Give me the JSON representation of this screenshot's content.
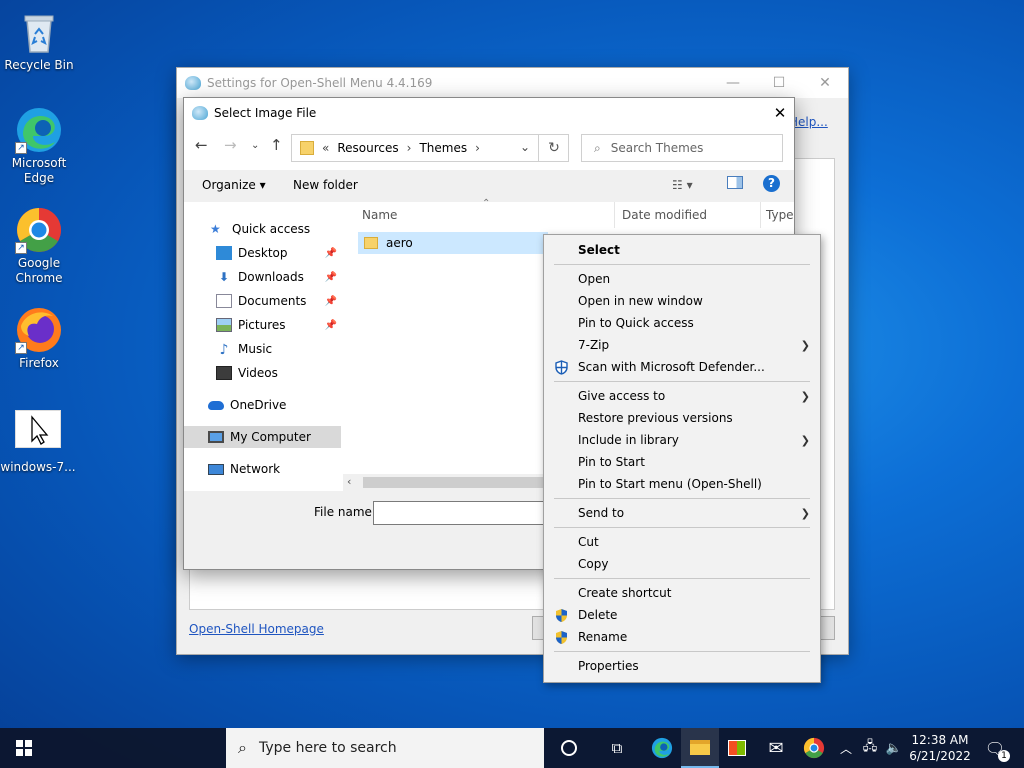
{
  "desktop": {
    "icons": [
      {
        "label": "Recycle Bin",
        "icon": "recycle-bin-icon"
      },
      {
        "label": "Microsoft Edge",
        "icon": "edge-icon"
      },
      {
        "label": "Google Chrome",
        "icon": "chrome-icon"
      },
      {
        "label": "Firefox",
        "icon": "firefox-icon"
      },
      {
        "label": "windows-7...",
        "icon": "cursor-file-icon"
      }
    ]
  },
  "settings_window": {
    "title": "Settings for Open-Shell Menu 4.4.169",
    "help_link": "Help...",
    "homepage_link": "Open-Shell Homepage"
  },
  "dialog": {
    "title": "Select Image File",
    "breadcrumb": [
      "«",
      "Resources",
      "›",
      "Themes",
      "›"
    ],
    "search_placeholder": "Search Themes",
    "toolbar": {
      "organize": "Organize ▾",
      "new_folder": "New folder"
    },
    "nav": [
      {
        "label": "Quick access",
        "pinned": false
      },
      {
        "label": "Desktop",
        "pinned": true
      },
      {
        "label": "Downloads",
        "pinned": true
      },
      {
        "label": "Documents",
        "pinned": true
      },
      {
        "label": "Pictures",
        "pinned": true
      },
      {
        "label": "Music",
        "pinned": false
      },
      {
        "label": "Videos",
        "pinned": false
      },
      {
        "label": "OneDrive",
        "pinned": false
      },
      {
        "label": "My Computer",
        "pinned": false
      },
      {
        "label": "Network",
        "pinned": false
      }
    ],
    "columns": {
      "name": "Name",
      "date": "Date modified",
      "type": "Type"
    },
    "files": [
      {
        "name": "aero"
      }
    ],
    "file_name_label": "File name:",
    "file_name_value": ""
  },
  "context_menu": {
    "items": [
      {
        "label": "Select",
        "bold": true
      },
      {
        "label": "Open"
      },
      {
        "label": "Open in new window"
      },
      {
        "label": "Pin to Quick access"
      },
      {
        "label": "7-Zip",
        "submenu": true
      },
      {
        "label": "Scan with Microsoft Defender...",
        "icon": "defender-icon"
      },
      {
        "label": "Give access to",
        "submenu": true
      },
      {
        "label": "Restore previous versions"
      },
      {
        "label": "Include in library",
        "submenu": true
      },
      {
        "label": "Pin to Start"
      },
      {
        "label": "Pin to Start menu (Open-Shell)"
      },
      {
        "label": "Send to",
        "submenu": true
      },
      {
        "label": "Cut"
      },
      {
        "label": "Copy"
      },
      {
        "label": "Create shortcut"
      },
      {
        "label": "Delete",
        "icon": "shield-icon"
      },
      {
        "label": "Rename",
        "icon": "shield-icon"
      },
      {
        "label": "Properties"
      }
    ]
  },
  "taskbar": {
    "search_placeholder": "Type here to search",
    "time": "12:38 AM",
    "date": "6/21/2022",
    "notification_count": "1"
  },
  "colors": {
    "selection": "#cce8ff",
    "link": "#1f55c0",
    "accent": "#0078d7"
  }
}
